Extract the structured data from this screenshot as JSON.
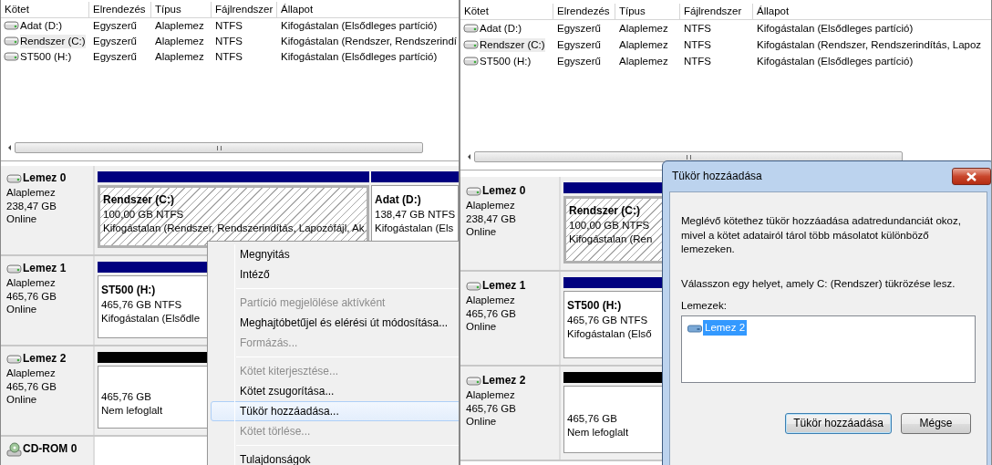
{
  "panes": [
    {
      "list": {
        "columns": [
          "Kötet",
          "Elrendezés",
          "Típus",
          "Fájlrendszer",
          "Állapot"
        ],
        "rows": [
          {
            "cells": [
              "Adat (D:)",
              "Egyszerű",
              "Alaplemez",
              "NTFS",
              "Kifogástalan (Elsődleges partíció)"
            ],
            "selected": false
          },
          {
            "cells": [
              "Rendszer (C:)",
              "Egyszerű",
              "Alaplemez",
              "NTFS",
              "Kifogástalan (Rendszer, Rendszerindí"
            ],
            "selected": true
          },
          {
            "cells": [
              "ST500 (H:)",
              "Egyszerű",
              "Alaplemez",
              "NTFS",
              "Kifogástalan (Elsődleges partíció)"
            ],
            "selected": false
          }
        ]
      },
      "disks": [
        {
          "kind": "disk",
          "name": "Lemez 0",
          "type": "Alaplemez",
          "size": "238,47 GB",
          "status": "Online",
          "partitions": [
            {
              "kind": "primary",
              "name": "Rendszer (C:)",
              "size": "100,00 GB NTFS",
              "status": "Kifogástalan (Rendszer, Rendszerindítás, Lapozófájl, Ak",
              "selected": true
            },
            {
              "kind": "primary",
              "name": "Adat (D:)",
              "size": "138,47 GB NTFS",
              "status": "Kifogástalan (Els",
              "selected": false
            }
          ]
        },
        {
          "kind": "disk",
          "name": "Lemez 1",
          "type": "Alaplemez",
          "size": "465,76 GB",
          "status": "Online",
          "partitions": [
            {
              "kind": "primary",
              "name": "ST500 (H:)",
              "size": "465,76 GB NTFS",
              "status": "Kifogástalan (Elsődle",
              "selected": false
            }
          ]
        },
        {
          "kind": "disk",
          "name": "Lemez 2",
          "type": "Alaplemez",
          "size": "465,76 GB",
          "status": "Online",
          "partitions": [
            {
              "kind": "unallocated",
              "size": "465,76 GB",
              "status": "Nem lefoglalt",
              "selected": false
            }
          ]
        },
        {
          "kind": "cdrom",
          "name": "CD-ROM 0"
        }
      ],
      "context_menu": {
        "items": [
          {
            "kind": "item",
            "label": "Megnyitás",
            "disabled": false,
            "highlighted": false
          },
          {
            "kind": "item",
            "label": "Intéző",
            "disabled": false,
            "highlighted": false
          },
          {
            "kind": "separator"
          },
          {
            "kind": "item",
            "label": "Partíció megjelölése aktívként",
            "disabled": true,
            "highlighted": false
          },
          {
            "kind": "item",
            "label": "Meghajtóbetűjel és elérési út módosítása...",
            "disabled": false,
            "highlighted": false
          },
          {
            "kind": "item",
            "label": "Formázás...",
            "disabled": true,
            "highlighted": false
          },
          {
            "kind": "separator"
          },
          {
            "kind": "item",
            "label": "Kötet kiterjesztése...",
            "disabled": true,
            "highlighted": false
          },
          {
            "kind": "item",
            "label": "Kötet zsugorítása...",
            "disabled": false,
            "highlighted": false
          },
          {
            "kind": "item",
            "label": "Tükör hozzáadása...",
            "disabled": false,
            "highlighted": true
          },
          {
            "kind": "item",
            "label": "Kötet törlése...",
            "disabled": true,
            "highlighted": false
          },
          {
            "kind": "separator"
          },
          {
            "kind": "item",
            "label": "Tulajdonságok",
            "disabled": false,
            "highlighted": false
          }
        ]
      }
    },
    {
      "list": {
        "columns": [
          "Kötet",
          "Elrendezés",
          "Típus",
          "Fájlrendszer",
          "Állapot"
        ],
        "rows": [
          {
            "cells": [
              "Adat (D:)",
              "Egyszerű",
              "Alaplemez",
              "NTFS",
              "Kifogástalan (Elsődleges partíció)"
            ],
            "selected": false
          },
          {
            "cells": [
              "Rendszer (C:)",
              "Egyszerű",
              "Alaplemez",
              "NTFS",
              "Kifogástalan (Rendszer, Rendszerindítás, Lapoz"
            ],
            "selected": true
          },
          {
            "cells": [
              "ST500 (H:)",
              "Egyszerű",
              "Alaplemez",
              "NTFS",
              "Kifogástalan (Elsődleges partíció)"
            ],
            "selected": false
          }
        ]
      },
      "disks": [
        {
          "kind": "disk",
          "name": "Lemez 0",
          "type": "Alaplemez",
          "size": "238,47 GB",
          "status": "Online",
          "partitions": [
            {
              "kind": "primary",
              "name": "Rendszer (C:)",
              "size": "100,00 GB NTFS",
              "status": "Kifogástalan (Ren",
              "selected": true
            }
          ]
        },
        {
          "kind": "disk",
          "name": "Lemez 1",
          "type": "Alaplemez",
          "size": "465,76 GB",
          "status": "Online",
          "partitions": [
            {
              "kind": "primary",
              "name": "ST500 (H:)",
              "size": "465,76 GB NTFS",
              "status": "Kifogástalan (Első",
              "selected": false
            }
          ]
        },
        {
          "kind": "disk",
          "name": "Lemez 2",
          "type": "Alaplemez",
          "size": "465,76 GB",
          "status": "Online",
          "partitions": [
            {
              "kind": "unallocated",
              "size": "465,76 GB",
              "status": "Nem lefoglalt",
              "selected": false
            }
          ]
        }
      ],
      "dialog": {
        "title": "Tükör hozzáadása",
        "message": "Meglévő kötethez tükör hozzáadása adatredundanciát okoz, mivel a kötet adatairól tárol több másolatot különböző lemezeken.",
        "prompt": "Válasszon egy helyet, amely C: (Rendszer) tükrözése lesz.",
        "list_label": "Lemezek:",
        "disks": [
          {
            "label": "Lemez 2",
            "selected": true
          }
        ],
        "buttons": [
          {
            "label": "Tükör hozzáadása",
            "default": true
          },
          {
            "label": "Mégse",
            "default": false
          }
        ]
      }
    }
  ]
}
